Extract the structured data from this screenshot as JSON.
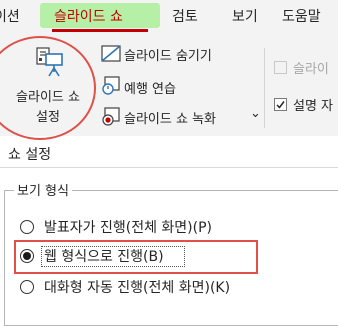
{
  "ribbon": {
    "tabs": [
      {
        "label": "이션",
        "active": false
      },
      {
        "label": "슬라이드 쇼",
        "active": true
      },
      {
        "label": "검토",
        "active": false
      },
      {
        "label": "보기",
        "active": false
      },
      {
        "label": "도움말",
        "active": false
      }
    ],
    "big_button_label_line1": "슬라이드 쇼",
    "big_button_label_line2": "설정",
    "commands": {
      "hide_slide": "슬라이드 숨기기",
      "rehearse": "예행 연습",
      "record": "슬라이드 쇼 녹화",
      "record_dropdown": "⌄"
    },
    "right_checkboxes": [
      {
        "label": "슬라이",
        "checked": false,
        "enabled": false
      },
      {
        "label": "설명 자",
        "checked": true,
        "enabled": true
      }
    ],
    "accent_color": "#c00000",
    "tab_highlight_color": "#b6f0a6",
    "annotation_color": "#e0504a"
  },
  "dialog": {
    "title": "쇼 설정",
    "group_title": "보기 형식",
    "options": [
      {
        "label": "발표자가 진행(전체 화면)(P)",
        "checked": false
      },
      {
        "label": "웹 형식으로 진행(B)",
        "checked": true
      },
      {
        "label": "대화형 자동 진행(전체 화면)(K)",
        "checked": false
      }
    ]
  }
}
